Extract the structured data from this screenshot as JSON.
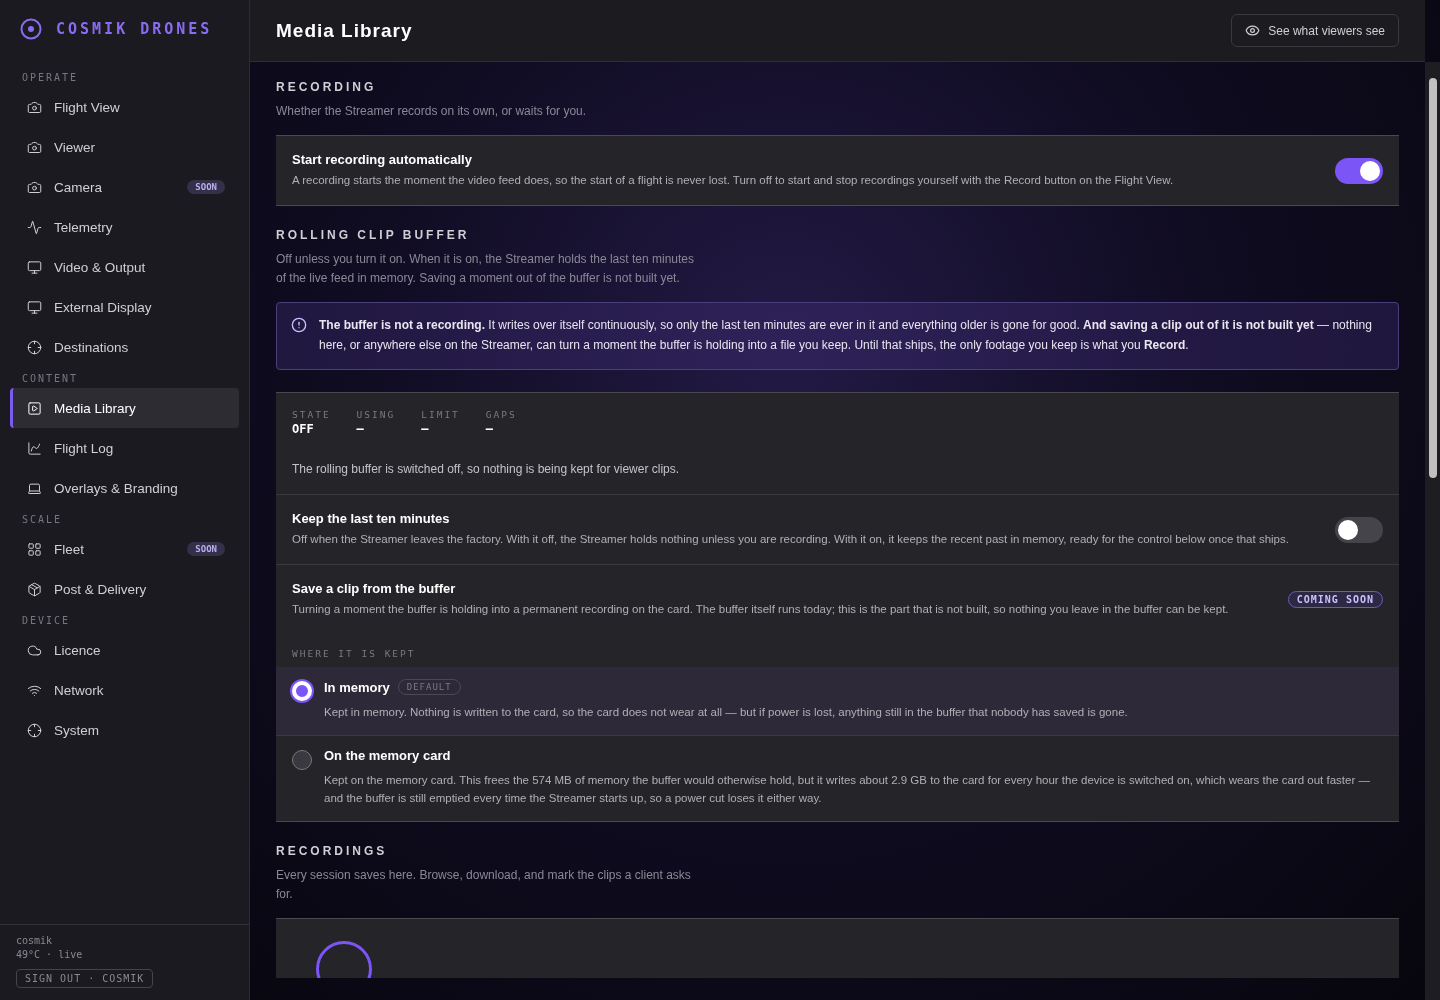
{
  "brand": {
    "name": "COSMIK DRONES"
  },
  "sidebar": {
    "sections": [
      {
        "title": "OPERATE",
        "items": [
          {
            "label": "Flight View",
            "kind": "camera",
            "selected": false
          },
          {
            "label": "Viewer",
            "kind": "camera",
            "selected": false
          },
          {
            "label": "Camera",
            "kind": "camera",
            "selected": false,
            "badge": "SOON"
          },
          {
            "label": "Telemetry",
            "kind": "pulse",
            "selected": false
          },
          {
            "label": "Video & Output",
            "kind": "monitor",
            "selected": false
          },
          {
            "label": "External Display",
            "kind": "monitor",
            "selected": false
          },
          {
            "label": "Destinations",
            "kind": "target",
            "selected": false
          }
        ]
      },
      {
        "title": "CONTENT",
        "items": [
          {
            "label": "Media Library",
            "kind": "play",
            "selected": true
          },
          {
            "label": "Flight Log",
            "kind": "chart",
            "selected": false
          },
          {
            "label": "Overlays & Branding",
            "kind": "laptop",
            "selected": false
          }
        ]
      },
      {
        "title": "SCALE",
        "items": [
          {
            "label": "Fleet",
            "kind": "grid",
            "selected": false,
            "badge": "SOON"
          },
          {
            "label": "Post & Delivery",
            "kind": "box",
            "selected": false
          }
        ]
      },
      {
        "title": "DEVICE",
        "items": [
          {
            "label": "Licence",
            "kind": "cloud",
            "selected": false
          },
          {
            "label": "Network",
            "kind": "wifi",
            "selected": false
          },
          {
            "label": "System",
            "kind": "target",
            "selected": false
          }
        ]
      }
    ],
    "footer": {
      "user": "cosmik",
      "status": "49°C · live",
      "sign_out": "SIGN OUT · COSMIK"
    }
  },
  "header": {
    "title": "Media Library",
    "action": "See what viewers see"
  },
  "recording": {
    "title": "RECORDING",
    "description": "Whether the Streamer records on its own, or waits for you.",
    "setting": {
      "title": "Start recording automatically",
      "description": "A recording starts the moment the video feed does, so the start of a flight is never lost. Turn off to start and stop recordings yourself with the Record button on the Flight View.",
      "on": true
    }
  },
  "buffer": {
    "title": "ROLLING CLIP BUFFER",
    "description": "Off unless you turn it on. When it is on, the Streamer holds the last ten minutes of the live feed in memory. Saving a moment out of the buffer is not built yet.",
    "notice": "**The buffer is not a recording.** It writes over itself continuously, so only the last ten minutes are ever in it and everything older is gone for good. **And saving a clip out of it is not built yet** — nothing here, or anywhere else on the Streamer, can turn a moment the buffer is holding into a file you keep. Until that ships, the only footage you keep is what you **Record**.",
    "stats": [
      {
        "label": "STATE",
        "value": "OFF"
      },
      {
        "label": "USING",
        "value": "—"
      },
      {
        "label": "LIMIT",
        "value": "—"
      },
      {
        "label": "GAPS",
        "value": "—"
      }
    ],
    "status": "The rolling buffer is switched off, so nothing is being kept for viewer clips.",
    "keep": {
      "title": "Keep the last ten minutes",
      "description": "Off when the Streamer leaves the factory. With it off, the Streamer holds nothing unless you are recording. With it on, it keeps the recent past in memory, ready for the control below once that ships.",
      "on": false
    },
    "save": {
      "title": "Save a clip from the buffer",
      "description": "Turning a moment the buffer is holding into a permanent recording on the card. The buffer itself runs today; this is the part that is not built, so nothing you leave in the buffer can be kept.",
      "badge": "COMING SOON"
    },
    "where_label": "WHERE IT IS KEPT",
    "options": [
      {
        "title": "In memory",
        "tag": "DEFAULT",
        "description": "Kept in memory. Nothing is written to the card, so the card does not wear at all — but if power is lost, anything still in the buffer that nobody has saved is gone.",
        "selected": true
      },
      {
        "title": "On the memory card",
        "description": "Kept on the memory card. This frees the 574 MB of memory the buffer would otherwise hold, but it writes about 2.9 GB to the card for every hour the device is switched on, which wears the card out faster — and the buffer is still emptied every time the Streamer starts up, so a power cut loses it either way.",
        "selected": false
      }
    ]
  },
  "recordings": {
    "title": "RECORDINGS",
    "description": "Every session saves here. Browse, download, and mark the clips a client asks for."
  }
}
